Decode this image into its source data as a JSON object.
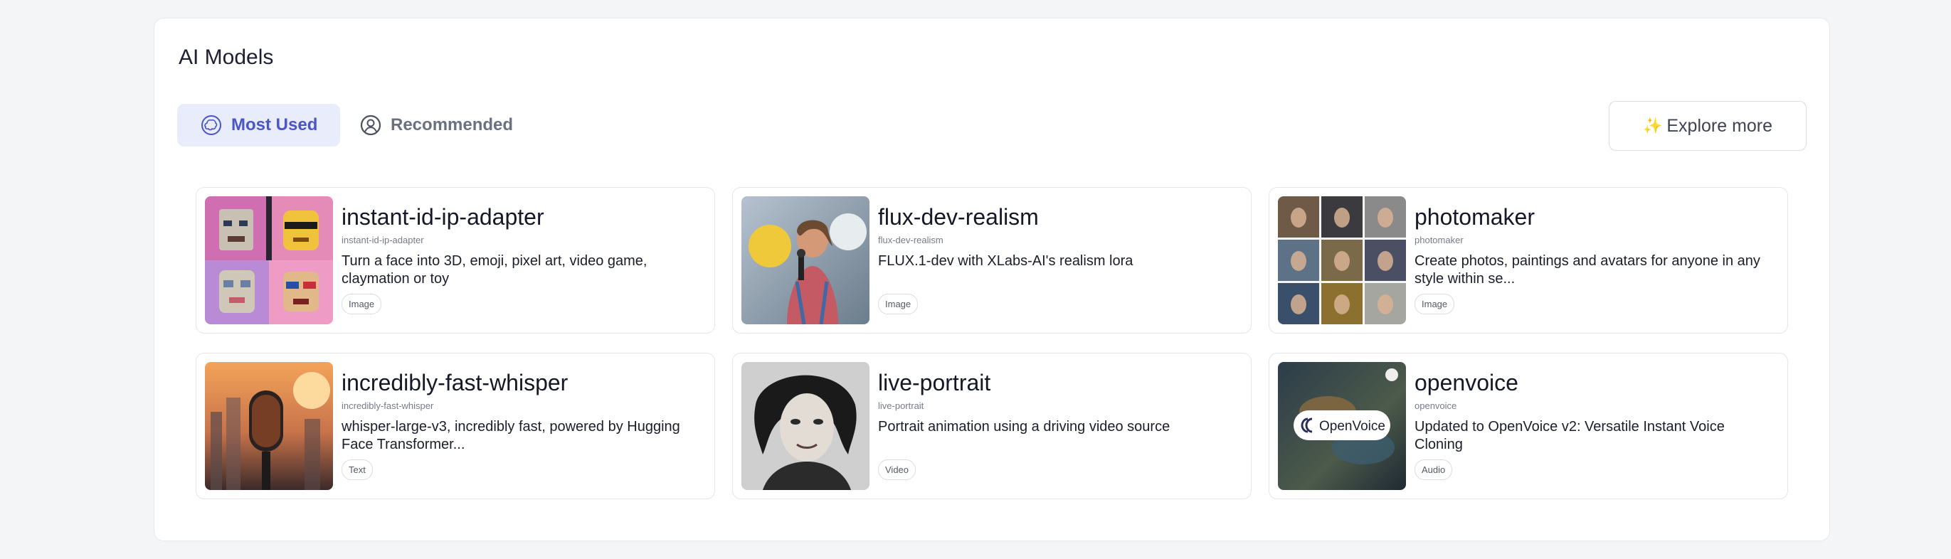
{
  "section": {
    "title": "AI Models"
  },
  "tabs": [
    {
      "label": "Most Used",
      "active": true,
      "icon": "brain-icon"
    },
    {
      "label": "Recommended",
      "active": false,
      "icon": "user-star-icon"
    }
  ],
  "explore": {
    "label": "Explore more",
    "icon": "sparkle-icon"
  },
  "models": [
    {
      "name": "instant-id-ip-adapter",
      "slug": "instant-id-ip-adapter",
      "description": "Turn a face into 3D, emoji, pixel art, video game, claymation or toy",
      "tag": "Image",
      "thumbnail": "pixel-faces-grid"
    },
    {
      "name": "flux-dev-realism",
      "slug": "flux-dev-realism",
      "description": "FLUX.1-dev with XLabs-AI's realism lora",
      "tag": "Image",
      "thumbnail": "speaker-woman-photo"
    },
    {
      "name": "photomaker",
      "slug": "photomaker",
      "description": "Create photos, paintings and avatars for anyone in any style within se...",
      "tag": "Image",
      "thumbnail": "portrait-collage-grid"
    },
    {
      "name": "incredibly-fast-whisper",
      "slug": "incredibly-fast-whisper",
      "description": "whisper-large-v3, incredibly fast, powered by Hugging Face Transformer...",
      "tag": "Text",
      "thumbnail": "microphone-city-sunset"
    },
    {
      "name": "live-portrait",
      "slug": "live-portrait",
      "description": "Portrait animation using a driving video source",
      "tag": "Video",
      "thumbnail": "bw-portrait-photo"
    },
    {
      "name": "openvoice",
      "slug": "openvoice",
      "description": "Updated to OpenVoice v2: Versatile Instant Voice Cloning",
      "tag": "Audio",
      "thumbnail": "openvoice-logo",
      "thumbnail_text": "OpenVoice"
    }
  ]
}
